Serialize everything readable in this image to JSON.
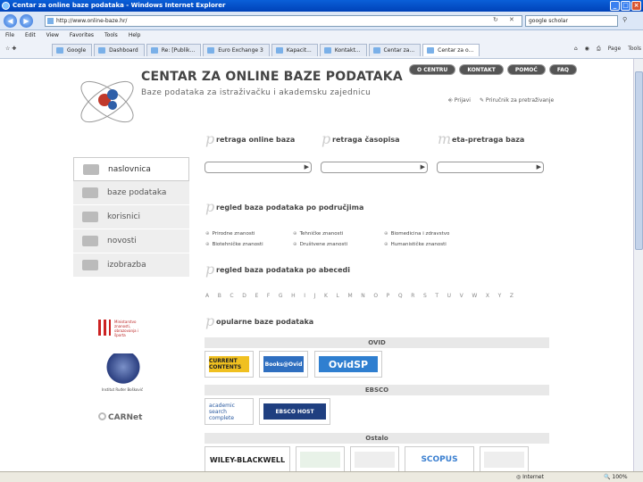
{
  "window": {
    "title": "Centar za online baze podataka - Windows Internet Explorer",
    "btn_min": "_",
    "btn_max": "□",
    "btn_close": "×"
  },
  "address": {
    "url": "http://www.online-baze.hr/",
    "search_text": "google scholar"
  },
  "menu": [
    "File",
    "Edit",
    "View",
    "Favorites",
    "Tools",
    "Help"
  ],
  "tabs": [
    "Google",
    "Dashboard",
    "Re: [Publik...",
    "Euro Exchange 3",
    "Kapacit...",
    "Kontakt...",
    "Centar za...",
    "Centar za o..."
  ],
  "toolbar": {
    "page": "Page",
    "tools": "Tools"
  },
  "site": {
    "brand_main": "CENTAR ZA ",
    "brand_strong": "ONLINE BAZE PODATAKA",
    "tagline": "Baze podataka za istraživačku i akademsku zajednicu",
    "topnav": [
      "O CENTRU",
      "KONTAKT",
      "POMOĆ",
      "FAQ"
    ],
    "util": [
      "Prijavi",
      "Priručnik za pretraživanje"
    ],
    "leftnav": [
      "naslovnica",
      "baze podataka",
      "korisnici",
      "novosti",
      "izobrazba"
    ],
    "search_sections": [
      "retraga online baza",
      "retraga časopisa",
      "eta-pretraga baza"
    ],
    "search_initials": [
      "p",
      "p",
      "m"
    ],
    "sec_initial": "p",
    "region_title": "regled baza podataka po područjima",
    "regions": [
      "Prirodne znanosti",
      "Tehničke znanosti",
      "Biomedicina i zdravstvo",
      "Biotehničke znanosti",
      "Društvene znanosti",
      "Humanističke znanosti"
    ],
    "alpha_title": "regled baza podataka po abecedi",
    "alphabet": [
      "A",
      "B",
      "C",
      "D",
      "E",
      "F",
      "G",
      "H",
      "I",
      "J",
      "K",
      "L",
      "M",
      "N",
      "O",
      "P",
      "Q",
      "R",
      "S",
      "T",
      "U",
      "V",
      "W",
      "X",
      "Y",
      "Z"
    ],
    "popular_title": "opularne baze podataka",
    "vendors": [
      "OVID",
      "EBSCO",
      "Ostalo"
    ],
    "ovid_tiles": [
      "CURRENT CONTENTS",
      "Books@Ovid",
      "OvidSP"
    ],
    "ebsco_tiles": [
      "academic search complete",
      "EBSCO HOST"
    ],
    "other_tiles": [
      "WILEY-BLACKWELL",
      "",
      "",
      "SCOPUS",
      ""
    ],
    "sponsors": {
      "ministry": "Ministarstvo znanosti, obrazovanja i športa",
      "irb": "Institut Ruđer Bošković",
      "carnet": "CARNet"
    }
  },
  "status": {
    "zone": "Internet",
    "zoom": "100%"
  }
}
